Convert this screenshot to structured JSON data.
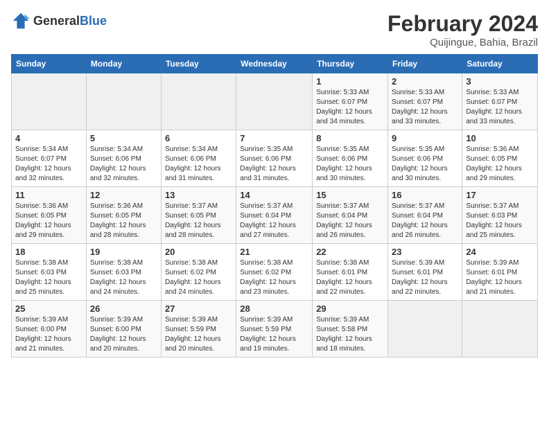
{
  "header": {
    "logo": {
      "general": "General",
      "blue": "Blue"
    },
    "title": "February 2024",
    "location": "Quijingue, Bahia, Brazil"
  },
  "columns": [
    "Sunday",
    "Monday",
    "Tuesday",
    "Wednesday",
    "Thursday",
    "Friday",
    "Saturday"
  ],
  "weeks": [
    [
      {
        "day": "",
        "empty": true
      },
      {
        "day": "",
        "empty": true
      },
      {
        "day": "",
        "empty": true
      },
      {
        "day": "",
        "empty": true
      },
      {
        "day": "1",
        "sunrise": "5:33 AM",
        "sunset": "6:07 PM",
        "daylight": "Daylight: 12 hours and 34 minutes."
      },
      {
        "day": "2",
        "sunrise": "5:33 AM",
        "sunset": "6:07 PM",
        "daylight": "Daylight: 12 hours and 33 minutes."
      },
      {
        "day": "3",
        "sunrise": "5:33 AM",
        "sunset": "6:07 PM",
        "daylight": "Daylight: 12 hours and 33 minutes."
      }
    ],
    [
      {
        "day": "4",
        "sunrise": "5:34 AM",
        "sunset": "6:07 PM",
        "daylight": "Daylight: 12 hours and 32 minutes."
      },
      {
        "day": "5",
        "sunrise": "5:34 AM",
        "sunset": "6:06 PM",
        "daylight": "Daylight: 12 hours and 32 minutes."
      },
      {
        "day": "6",
        "sunrise": "5:34 AM",
        "sunset": "6:06 PM",
        "daylight": "Daylight: 12 hours and 31 minutes."
      },
      {
        "day": "7",
        "sunrise": "5:35 AM",
        "sunset": "6:06 PM",
        "daylight": "Daylight: 12 hours and 31 minutes."
      },
      {
        "day": "8",
        "sunrise": "5:35 AM",
        "sunset": "6:06 PM",
        "daylight": "Daylight: 12 hours and 30 minutes."
      },
      {
        "day": "9",
        "sunrise": "5:35 AM",
        "sunset": "6:06 PM",
        "daylight": "Daylight: 12 hours and 30 minutes."
      },
      {
        "day": "10",
        "sunrise": "5:36 AM",
        "sunset": "6:05 PM",
        "daylight": "Daylight: 12 hours and 29 minutes."
      }
    ],
    [
      {
        "day": "11",
        "sunrise": "5:36 AM",
        "sunset": "6:05 PM",
        "daylight": "Daylight: 12 hours and 29 minutes."
      },
      {
        "day": "12",
        "sunrise": "5:36 AM",
        "sunset": "6:05 PM",
        "daylight": "Daylight: 12 hours and 28 minutes."
      },
      {
        "day": "13",
        "sunrise": "5:37 AM",
        "sunset": "6:05 PM",
        "daylight": "Daylight: 12 hours and 28 minutes."
      },
      {
        "day": "14",
        "sunrise": "5:37 AM",
        "sunset": "6:04 PM",
        "daylight": "Daylight: 12 hours and 27 minutes."
      },
      {
        "day": "15",
        "sunrise": "5:37 AM",
        "sunset": "6:04 PM",
        "daylight": "Daylight: 12 hours and 26 minutes."
      },
      {
        "day": "16",
        "sunrise": "5:37 AM",
        "sunset": "6:04 PM",
        "daylight": "Daylight: 12 hours and 26 minutes."
      },
      {
        "day": "17",
        "sunrise": "5:37 AM",
        "sunset": "6:03 PM",
        "daylight": "Daylight: 12 hours and 25 minutes."
      }
    ],
    [
      {
        "day": "18",
        "sunrise": "5:38 AM",
        "sunset": "6:03 PM",
        "daylight": "Daylight: 12 hours and 25 minutes."
      },
      {
        "day": "19",
        "sunrise": "5:38 AM",
        "sunset": "6:03 PM",
        "daylight": "Daylight: 12 hours and 24 minutes."
      },
      {
        "day": "20",
        "sunrise": "5:38 AM",
        "sunset": "6:02 PM",
        "daylight": "Daylight: 12 hours and 24 minutes."
      },
      {
        "day": "21",
        "sunrise": "5:38 AM",
        "sunset": "6:02 PM",
        "daylight": "Daylight: 12 hours and 23 minutes."
      },
      {
        "day": "22",
        "sunrise": "5:38 AM",
        "sunset": "6:01 PM",
        "daylight": "Daylight: 12 hours and 22 minutes."
      },
      {
        "day": "23",
        "sunrise": "5:39 AM",
        "sunset": "6:01 PM",
        "daylight": "Daylight: 12 hours and 22 minutes."
      },
      {
        "day": "24",
        "sunrise": "5:39 AM",
        "sunset": "6:01 PM",
        "daylight": "Daylight: 12 hours and 21 minutes."
      }
    ],
    [
      {
        "day": "25",
        "sunrise": "5:39 AM",
        "sunset": "6:00 PM",
        "daylight": "Daylight: 12 hours and 21 minutes."
      },
      {
        "day": "26",
        "sunrise": "5:39 AM",
        "sunset": "6:00 PM",
        "daylight": "Daylight: 12 hours and 20 minutes."
      },
      {
        "day": "27",
        "sunrise": "5:39 AM",
        "sunset": "5:59 PM",
        "daylight": "Daylight: 12 hours and 20 minutes."
      },
      {
        "day": "28",
        "sunrise": "5:39 AM",
        "sunset": "5:59 PM",
        "daylight": "Daylight: 12 hours and 19 minutes."
      },
      {
        "day": "29",
        "sunrise": "5:39 AM",
        "sunset": "5:58 PM",
        "daylight": "Daylight: 12 hours and 18 minutes."
      },
      {
        "day": "",
        "empty": true
      },
      {
        "day": "",
        "empty": true
      }
    ]
  ]
}
